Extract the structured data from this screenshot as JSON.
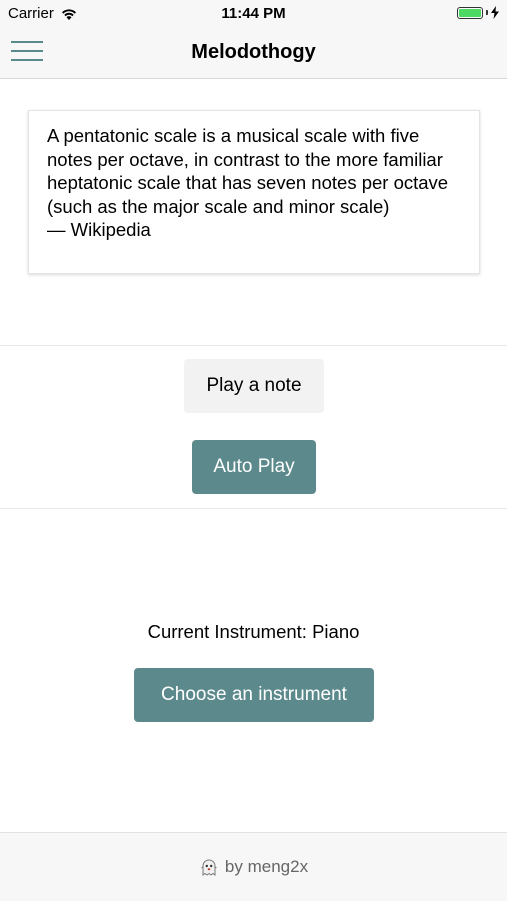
{
  "status_bar": {
    "carrier": "Carrier",
    "time": "11:44 PM",
    "battery_level": 1.0,
    "battery_color": "#4cd964"
  },
  "nav": {
    "title": "Melodothogy",
    "menu_icon": "hamburger-menu-icon"
  },
  "quote": {
    "text": "A pentatonic scale is a musical scale with five notes per octave, in contrast to the more familiar heptatonic scale that has seven notes per octave (such as the major scale and minor scale)",
    "source": "— Wikipedia"
  },
  "buttons": {
    "play_note": "Play a note",
    "auto_play": "Auto Play",
    "choose_instrument": "Choose an instrument"
  },
  "instrument": {
    "current": "Current Instrument: Piano"
  },
  "footer": {
    "icon": "ghost-icon",
    "text": "by meng2x"
  },
  "colors": {
    "accent": "#5c8a8c",
    "light_button": "#f2f2f2"
  }
}
